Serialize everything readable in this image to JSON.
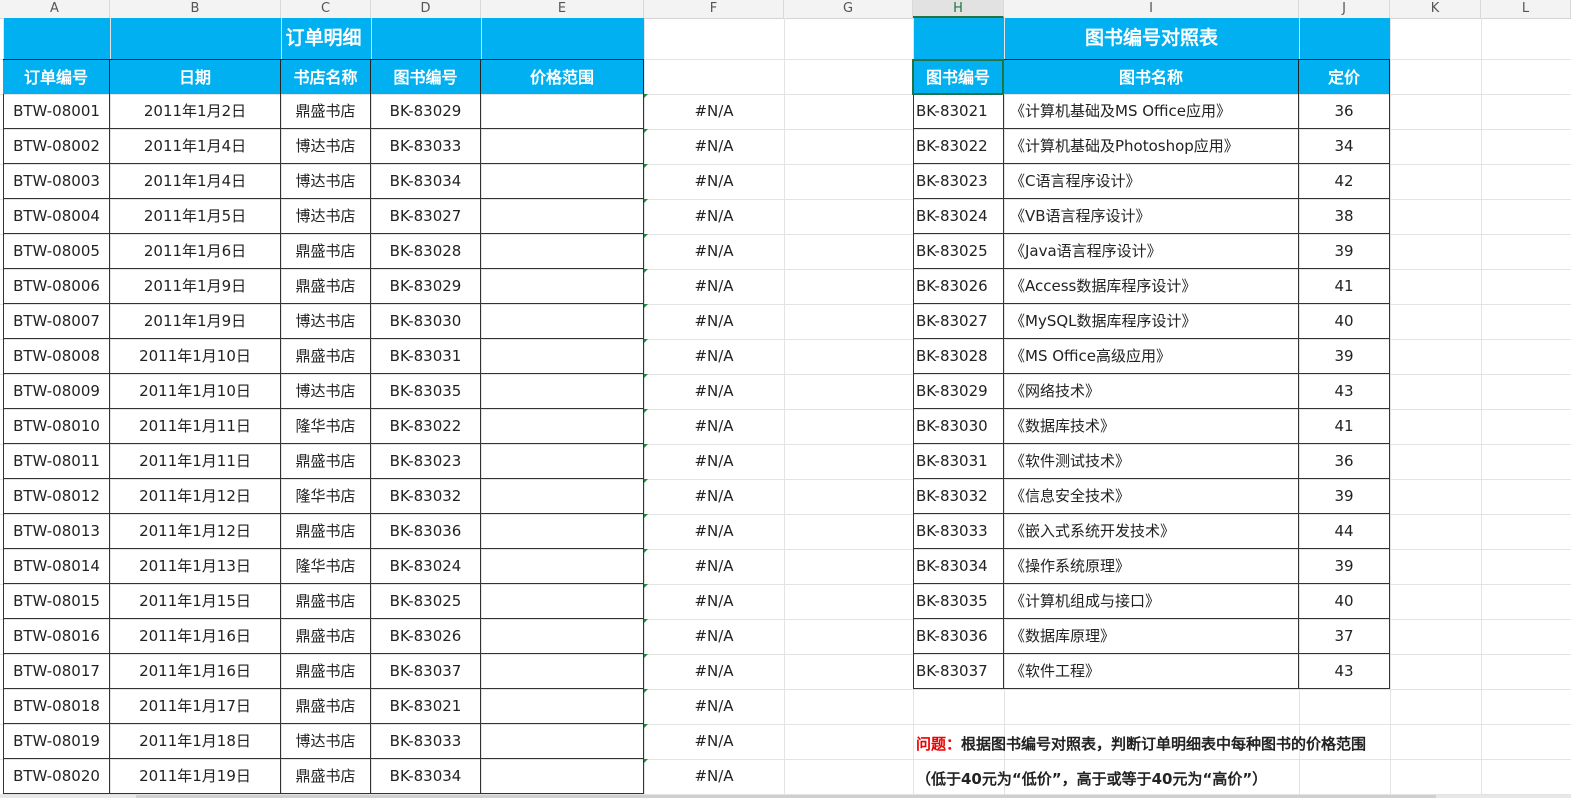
{
  "columns": [
    "A",
    "B",
    "C",
    "D",
    "E",
    "F",
    "G",
    "H",
    "I",
    "J",
    "K",
    "L"
  ],
  "left_table": {
    "title": "订单明细",
    "headers": [
      "订单编号",
      "日期",
      "书店名称",
      "图书编号",
      "价格范围"
    ],
    "rows": [
      [
        "BTW-08001",
        "2011年1月2日",
        "鼎盛书店",
        "BK-83029",
        "",
        "#N/A"
      ],
      [
        "BTW-08002",
        "2011年1月4日",
        "博达书店",
        "BK-83033",
        "",
        "#N/A"
      ],
      [
        "BTW-08003",
        "2011年1月4日",
        "博达书店",
        "BK-83034",
        "",
        "#N/A"
      ],
      [
        "BTW-08004",
        "2011年1月5日",
        "博达书店",
        "BK-83027",
        "",
        "#N/A"
      ],
      [
        "BTW-08005",
        "2011年1月6日",
        "鼎盛书店",
        "BK-83028",
        "",
        "#N/A"
      ],
      [
        "BTW-08006",
        "2011年1月9日",
        "鼎盛书店",
        "BK-83029",
        "",
        "#N/A"
      ],
      [
        "BTW-08007",
        "2011年1月9日",
        "博达书店",
        "BK-83030",
        "",
        "#N/A"
      ],
      [
        "BTW-08008",
        "2011年1月10日",
        "鼎盛书店",
        "BK-83031",
        "",
        "#N/A"
      ],
      [
        "BTW-08009",
        "2011年1月10日",
        "博达书店",
        "BK-83035",
        "",
        "#N/A"
      ],
      [
        "BTW-08010",
        "2011年1月11日",
        "隆华书店",
        "BK-83022",
        "",
        "#N/A"
      ],
      [
        "BTW-08011",
        "2011年1月11日",
        "鼎盛书店",
        "BK-83023",
        "",
        "#N/A"
      ],
      [
        "BTW-08012",
        "2011年1月12日",
        "隆华书店",
        "BK-83032",
        "",
        "#N/A"
      ],
      [
        "BTW-08013",
        "2011年1月12日",
        "鼎盛书店",
        "BK-83036",
        "",
        "#N/A"
      ],
      [
        "BTW-08014",
        "2011年1月13日",
        "隆华书店",
        "BK-83024",
        "",
        "#N/A"
      ],
      [
        "BTW-08015",
        "2011年1月15日",
        "鼎盛书店",
        "BK-83025",
        "",
        "#N/A"
      ],
      [
        "BTW-08016",
        "2011年1月16日",
        "鼎盛书店",
        "BK-83026",
        "",
        "#N/A"
      ],
      [
        "BTW-08017",
        "2011年1月16日",
        "鼎盛书店",
        "BK-83037",
        "",
        "#N/A"
      ],
      [
        "BTW-08018",
        "2011年1月17日",
        "鼎盛书店",
        "BK-83021",
        "",
        "#N/A"
      ],
      [
        "BTW-08019",
        "2011年1月18日",
        "博达书店",
        "BK-83033",
        "",
        "#N/A"
      ],
      [
        "BTW-08020",
        "2011年1月19日",
        "鼎盛书店",
        "BK-83034",
        "",
        "#N/A"
      ]
    ]
  },
  "right_table": {
    "title": "图书编号对照表",
    "headers": [
      "图书编号",
      "图书名称",
      "定价"
    ],
    "rows": [
      [
        "BK-83021",
        "《计算机基础及MS Office应用》",
        "36"
      ],
      [
        "BK-83022",
        "《计算机基础及Photoshop应用》",
        "34"
      ],
      [
        "BK-83023",
        "《C语言程序设计》",
        "42"
      ],
      [
        "BK-83024",
        "《VB语言程序设计》",
        "38"
      ],
      [
        "BK-83025",
        "《Java语言程序设计》",
        "39"
      ],
      [
        "BK-83026",
        "《Access数据库程序设计》",
        "41"
      ],
      [
        "BK-83027",
        "《MySQL数据库程序设计》",
        "40"
      ],
      [
        "BK-83028",
        "《MS Office高级应用》",
        "39"
      ],
      [
        "BK-83029",
        "《网络技术》",
        "43"
      ],
      [
        "BK-83030",
        "《数据库技术》",
        "41"
      ],
      [
        "BK-83031",
        "《软件测试技术》",
        "36"
      ],
      [
        "BK-83032",
        "《信息安全技术》",
        "39"
      ],
      [
        "BK-83033",
        "《嵌入式系统开发技术》",
        "44"
      ],
      [
        "BK-83034",
        "《操作系统原理》",
        "39"
      ],
      [
        "BK-83035",
        "《计算机组成与接口》",
        "40"
      ],
      [
        "BK-83036",
        "《数据库原理》",
        "37"
      ],
      [
        "BK-83037",
        "《软件工程》",
        "43"
      ]
    ]
  },
  "question": {
    "label": "问题：",
    "line1": "根据图书编号对照表，判断订单明细表中每种图书的价格范围",
    "line2": "（低于40元为“低价”，高于或等于40元为“高价”）"
  },
  "selected_column": "H",
  "colors": {
    "header_bg": "#00b0f0",
    "header_text": "#ffffff",
    "selection": "#217346",
    "question_label": "#ee0000"
  }
}
